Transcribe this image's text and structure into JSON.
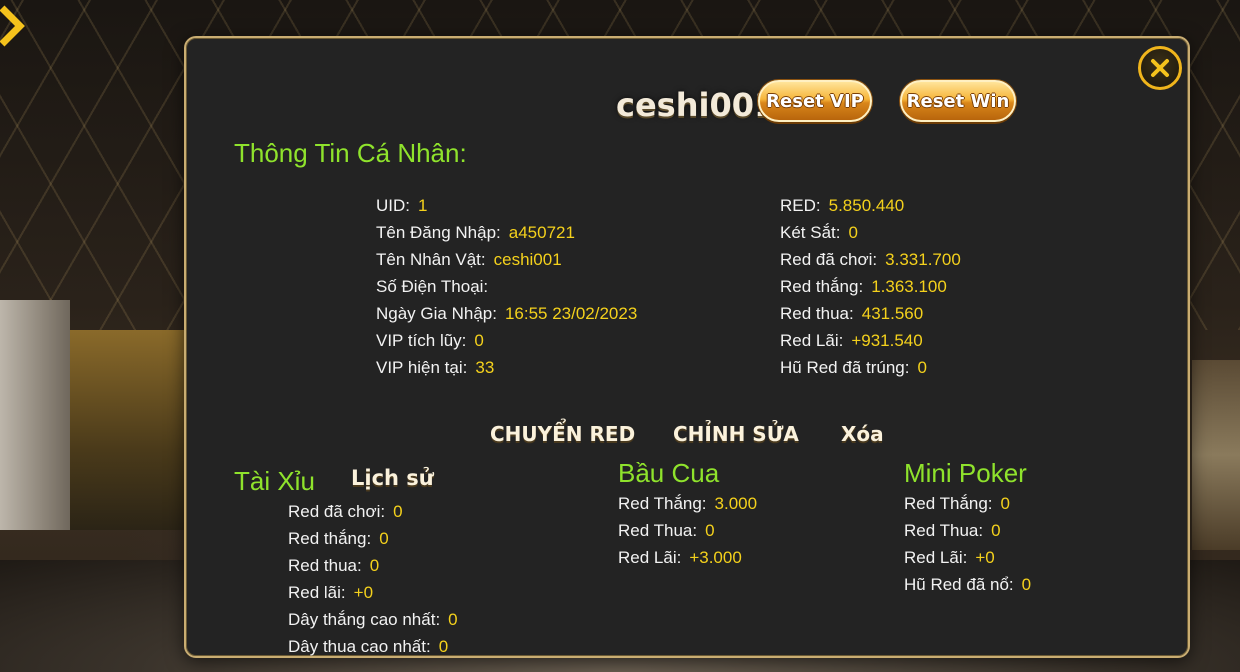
{
  "window": {
    "username": "ceshi001",
    "reset_vip_label": "Reset VIP",
    "reset_win_label": "Reset Win",
    "close_icon": "close-x-icon",
    "back_icon": "chevron-right-icon",
    "accent_color": "#8fe32c",
    "value_color": "#f4d11c",
    "border_color": "#c9ad72"
  },
  "profile": {
    "title": "Thông Tin Cá Nhân:",
    "left": [
      {
        "label": "UID:",
        "value": "1"
      },
      {
        "label": "Tên Đăng Nhập:",
        "value": "a450721"
      },
      {
        "label": "Tên Nhân Vật:",
        "value": "ceshi001"
      },
      {
        "label": "Số Điện Thoại:",
        "value": ""
      },
      {
        "label": "Ngày Gia Nhập:",
        "value": "16:55 23/02/2023"
      },
      {
        "label": "VIP tích lũy:",
        "value": "0"
      },
      {
        "label": "VIP hiện tại:",
        "value": "33"
      }
    ],
    "right": [
      {
        "label": "RED:",
        "value": "5.850.440"
      },
      {
        "label": "Két Sắt:",
        "value": "0"
      },
      {
        "label": "Red đã chơi:",
        "value": "3.331.700"
      },
      {
        "label": "Red thắng:",
        "value": "1.363.100"
      },
      {
        "label": "Red thua:",
        "value": "431.560"
      },
      {
        "label": "Red Lãi:",
        "value": "+931.540"
      },
      {
        "label": "Hũ Red đã trúng:",
        "value": "0"
      }
    ]
  },
  "actions": {
    "transfer": "CHUYỂN RED",
    "edit": "CHỈNH SỬA",
    "delete": "Xóa"
  },
  "taixiu": {
    "title": "Tài Xỉu",
    "history_link": "Lịch sử",
    "rows": [
      {
        "label": "Red đã chơi:",
        "value": "0"
      },
      {
        "label": "Red thắng:",
        "value": "0"
      },
      {
        "label": "Red thua:",
        "value": "0"
      },
      {
        "label": "Red lãi:",
        "value": "+0"
      },
      {
        "label": "Dây thắng cao nhất:",
        "value": "0"
      },
      {
        "label": "Dây thua cao nhất:",
        "value": "0"
      }
    ]
  },
  "baucua": {
    "title": "Bầu Cua",
    "rows": [
      {
        "label": "Red Thắng:",
        "value": "3.000"
      },
      {
        "label": "Red Thua:",
        "value": "0"
      },
      {
        "label": "Red Lãi:",
        "value": "+3.000"
      }
    ]
  },
  "minipoker": {
    "title": "Mini Poker",
    "rows": [
      {
        "label": "Red Thắng:",
        "value": "0"
      },
      {
        "label": "Red Thua:",
        "value": "0"
      },
      {
        "label": "Red Lãi:",
        "value": "+0"
      },
      {
        "label": "Hũ Red đã nổ:",
        "value": "0"
      }
    ]
  }
}
